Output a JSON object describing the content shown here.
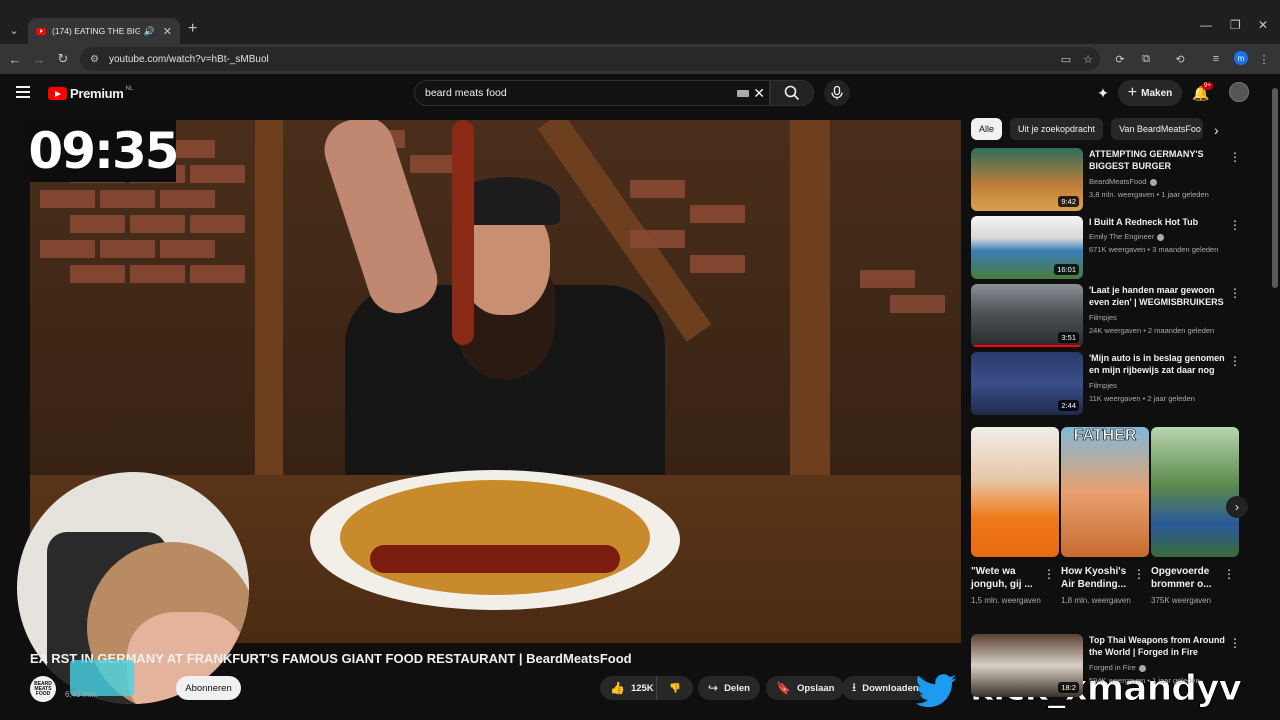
{
  "browser": {
    "tab_title": "(174) EATING THE BIGGEST",
    "url": "youtube.com/watch?v=hBt-_sMBuol",
    "profile_initial": "m"
  },
  "masthead": {
    "logo_text": "Premium",
    "region": "NL",
    "search_value": "beard meats food",
    "create_label": "Maken",
    "notification_count": "9+"
  },
  "player": {
    "timer": "09:35"
  },
  "video": {
    "title": "EATING THE BIGGEST WURST IN GERMANY AT FRANKFURT'S FAMOUS GIANT FOOD RESTAURANT | BeardMeatsFood",
    "title_visible": "EA                    RST IN GERMANY AT FRANKFURT'S FAMOUS GIANT FOOD RESTAURANT | BeardMeatsFood",
    "channel_avatar_text": "BEARD MEATS FOOD",
    "subscribers": "6,45 mln.",
    "subscribe_label": "Abonneren",
    "likes": "125K",
    "share_label": "Delen",
    "save_label": "Opslaan",
    "download_label": "Downloaden"
  },
  "overlay": {
    "brand_text": "kick_xmandyv"
  },
  "sidebar": {
    "chips": [
      "Alle",
      "Uit je zoekopdracht",
      "Van BeardMeatsFoo"
    ],
    "recommendations": [
      {
        "title": "ATTEMPTING GERMANY'S BIGGEST BURGER CHALLENG...",
        "channel": "BeardMeatsFood",
        "verified": true,
        "views": "3,8 mln. weergaven",
        "age": "1 jaar geleden",
        "duration": "9:42",
        "progress": 0
      },
      {
        "title": "I Built A Redneck Hot Tub",
        "channel": "Emily The Engineer",
        "verified": true,
        "views": "671K weergaven",
        "age": "3 maanden geleden",
        "duration": "16:01",
        "progress": 0
      },
      {
        "title": "'Laat je handen maar gewoon even zien' | WEGMISBRUIKERS",
        "channel": "Filmpjes",
        "verified": false,
        "views": "24K weergaven",
        "age": "2 maanden geleden",
        "duration": "3:51",
        "progress": 100
      },
      {
        "title": "'Mijn auto is in beslag genomen en mijn rijbewijs zat daar nog i...",
        "channel": "Filmpjes",
        "verified": false,
        "views": "11K weergaven",
        "age": "2 jaar geleden",
        "duration": "2:44",
        "progress": 0
      }
    ],
    "shorts": [
      {
        "title": "\"Wete wa jonguh, gij ...",
        "views": "1,5 mln. weergaven",
        "thumb_text": ""
      },
      {
        "title": "How Kyoshi's Air Bending...",
        "views": "1,8 mln. weergaven",
        "thumb_text": "FATHER"
      },
      {
        "title": "Opgevoerde brommer o...",
        "views": "375K weergaven",
        "thumb_text": ""
      }
    ],
    "bottom_rec": {
      "title": "Top Thai Weapons from Around the World | Forged in Fire",
      "channel": "Forged in Fire",
      "verified": true,
      "views": "594K weergaven",
      "age": "1 jaar geleden",
      "duration": "18:2"
    }
  },
  "colors": {
    "youtube_red": "#ff0000",
    "background": "#0f0f0f",
    "overlay_cyan": "#47d3e6",
    "twitter_blue": "#1d9bf0"
  }
}
